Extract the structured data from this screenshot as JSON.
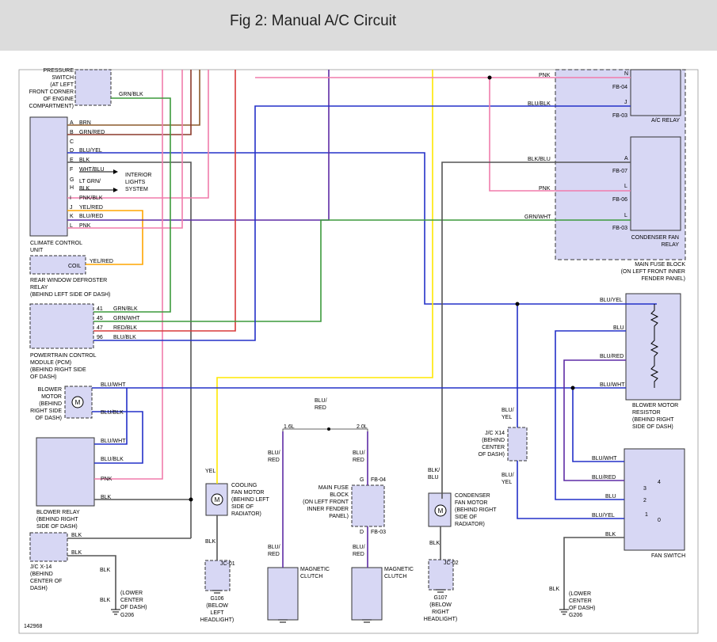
{
  "title": "Fig 2: Manual A/C Circuit",
  "figure_id": "142968",
  "colors": {
    "header_bg": "#dcdcdc",
    "component_fill": "#d7d7f4",
    "wire_pink": "#f07cab",
    "wire_green": "#3c9a3c",
    "wire_brown": "#8b5a2b",
    "wire_red": "#d83a3a",
    "wire_blue": "#2330c8",
    "wire_yellow": "#ffe800",
    "wire_orange": "#ffa500",
    "wire_purple": "#5e2ca5",
    "wire_gray": "#555555"
  },
  "components": {
    "pressure_switch": [
      "PRESSURE",
      "SWITCH",
      "(AT LEFT",
      "FRONT CORNER",
      "OF ENGINE",
      "COMPARTMENT)"
    ],
    "climate_control": [
      "CLIMATE CONTROL",
      "UNIT"
    ],
    "interior_lights": [
      "INTERIOR",
      "LIGHTS",
      "SYSTEM"
    ],
    "coil": "COIL",
    "rear_defroster": [
      "REAR WINDOW DEFROSTER",
      "RELAY",
      "(BEHIND LEFT SIDE OF DASH)"
    ],
    "pcm": [
      "POWERTRAIN CONTROL",
      "MODULE (PCM)",
      "(BEHIND RIGHT SIDE",
      "OF DASH)"
    ],
    "blower_motor": [
      "BLOWER",
      "MOTOR",
      "(BEHIND",
      "RIGHT SIDE",
      "OF DASH)"
    ],
    "blower_relay": [
      "BLOWER RELAY",
      "(BEHIND RIGHT",
      "SIDE OF DASH)"
    ],
    "jc_x14_left": [
      "J/C X-14",
      "(BEHIND",
      "CENTER OF",
      "DASH)"
    ],
    "g206_left": [
      "(LOWER",
      "CENTER",
      "OF DASH)"
    ],
    "ground_g206": "G206",
    "cooling_fan": [
      "COOLING",
      "FAN MOTOR",
      "(BEHIND LEFT",
      "SIDE OF",
      "RADIATOR)"
    ],
    "jc01": "JC-01",
    "g106": [
      "G106",
      "(BELOW",
      "LEFT",
      "HEADLIGHT)"
    ],
    "engine_16": "1.6L",
    "engine_20": "2.0L",
    "magnetic_clutch": [
      "MAGNETIC",
      "CLUTCH"
    ],
    "main_fuse_block_center": [
      "MAIN FUSE",
      "BLOCK",
      "(ON LEFT FRONT",
      "INNER FENDER",
      "PANEL)"
    ],
    "fb04": "FB-04",
    "fb03": "FB-03",
    "fuse_g": "G",
    "fuse_d": "D",
    "condenser_fan": [
      "CONDENSER",
      "FAN MOTOR",
      "(BEHIND RIGHT",
      "SIDE OF",
      "RADIATOR)"
    ],
    "jc02": "JC-02",
    "g107": [
      "G107",
      "(BELOW",
      "RIGHT",
      "HEADLIGHT)"
    ],
    "jc_x14_right": [
      "J/C X14",
      "(BEHIND",
      "CENTER",
      "OF DASH)"
    ],
    "ac_relay": "A/C RELAY",
    "condenser_relay": [
      "CONDENSER FAN",
      "RELAY"
    ],
    "main_fuse_block_right": [
      "MAIN FUSE BLOCK",
      "(ON LEFT FRONT INNER",
      "FENDER PANEL)"
    ],
    "blower_resistor": [
      "BLOWER MOTOR",
      "RESISTOR",
      "(BEHIND RIGHT",
      "SIDE OF DASH)"
    ],
    "fan_switch": "FAN SWITCH",
    "g206_right": [
      "(LOWER",
      "CENTER",
      "OF DASH)"
    ]
  },
  "labels": {
    "ccu_pins": [
      "A",
      "B",
      "C",
      "D",
      "E",
      "F",
      "G",
      "H",
      "I",
      "J",
      "K",
      "L"
    ],
    "ccu_wires": [
      "BRN",
      "GRN/RED",
      "",
      "BLU/YEL",
      "BLK",
      "WHT/BLU",
      "LT GRN/",
      "BLK",
      "PNK/BLK",
      "YEL/RED",
      "BLU/RED",
      "PNK"
    ],
    "pcm_pins": [
      "41",
      "45",
      "47",
      "96"
    ],
    "pcm_wires": [
      "GRN/BLK",
      "GRN/WHT",
      "RED/BLK",
      "BLU/BLK"
    ],
    "grn_blk": "GRN/BLK",
    "yel_red": "YEL/RED",
    "blu_wht": "BLU/WHT",
    "blu_blk": "BLU/BLK",
    "pnk": "PNK",
    "blk": "BLK",
    "yel": "YEL",
    "blu_red": "BLU/RED",
    "blu_red_a": "BLU/",
    "blu_red_b": "RED",
    "blu_yel_a": "BLU/",
    "blu_yel_b": "YEL",
    "blk_blu_a": "BLK/",
    "blk_blu_b": "BLU",
    "blk_blu": "BLK/BLU",
    "grn_wht": "GRN/WHT",
    "blu": "BLU",
    "blu_yel": "BLU/YEL",
    "fb04": "FB-04",
    "fb03": "FB-03",
    "fb07": "FB-07",
    "fb06": "FB-06",
    "pin_n": "N",
    "pin_j": "J",
    "pin_a": "A",
    "pin_l": "L",
    "fs_4": "4",
    "fs_3": "3",
    "fs_2": "2",
    "fs_1": "1",
    "fs_0": "0"
  }
}
